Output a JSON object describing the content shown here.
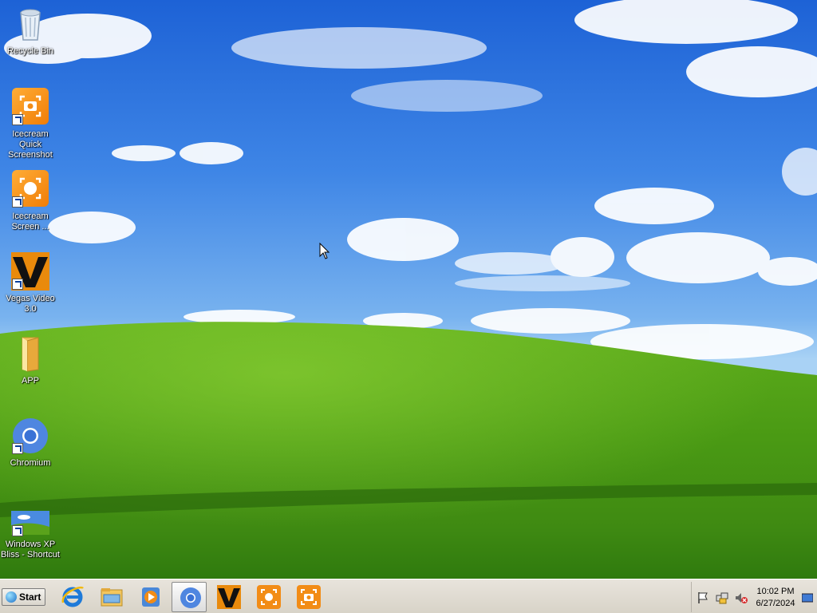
{
  "desktop": {
    "icons": [
      {
        "label": "Recycle Bin"
      },
      {
        "label": "Icecream Quick Screenshot"
      },
      {
        "label": "Icecream Screen ..."
      },
      {
        "label": "Vegas Video 3.0"
      },
      {
        "label": "APP"
      },
      {
        "label": "Chromium"
      },
      {
        "label": "Windows XP Bliss - Shortcut"
      }
    ]
  },
  "taskbar": {
    "start_label": "Start",
    "pinned": [
      {
        "icon": "internet-explorer-icon"
      },
      {
        "icon": "file-explorer-icon"
      },
      {
        "icon": "media-player-icon"
      },
      {
        "icon": "chromium-icon",
        "active": true
      },
      {
        "icon": "vegas-icon"
      },
      {
        "icon": "icecream-screen-recorder-icon"
      },
      {
        "icon": "icecream-screenshot-icon"
      }
    ],
    "tray": {
      "time": "10:02 PM",
      "date": "6/27/2024"
    }
  },
  "colors": {
    "sky": "#2f74df",
    "grass": "#4f9a1a",
    "taskbar": "#dcd7ce",
    "icecream_orange": "#f28c16"
  }
}
